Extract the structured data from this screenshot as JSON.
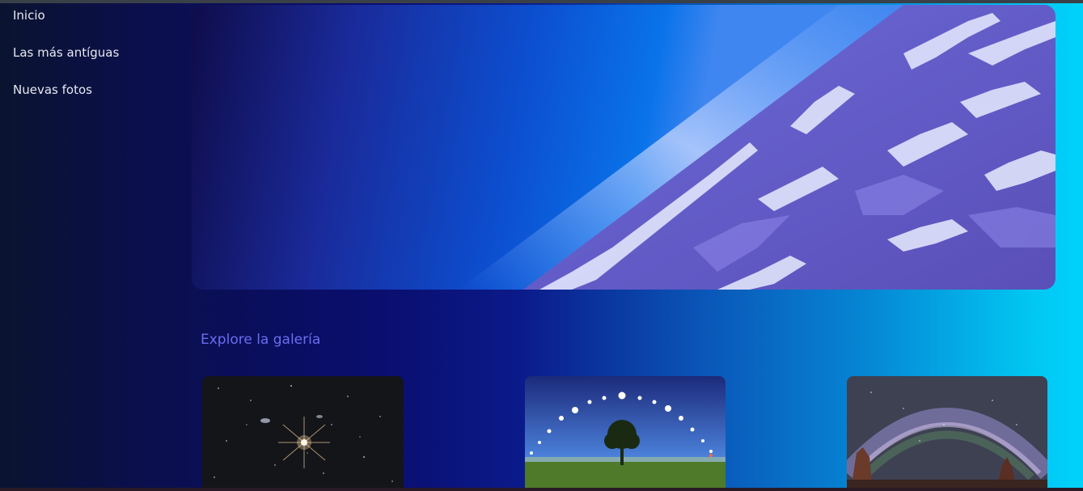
{
  "nav": {
    "items": [
      {
        "label": "Inicio"
      },
      {
        "label": "Las más antíguas"
      },
      {
        "label": "Nuevas fotos"
      }
    ]
  },
  "hero": {
    "image_icon": "earth-horizon-photo"
  },
  "gallery": {
    "title": "Explore la galería",
    "cards": [
      {
        "icon": "bright-star-photo"
      },
      {
        "icon": "sun-arc-tree-photo"
      },
      {
        "icon": "milky-way-arch-photo"
      }
    ]
  },
  "colors": {
    "nav_text": "#e6e8ef",
    "gallery_title": "#6c6cf0",
    "gradient_left": "#0a1430",
    "gradient_right": "#00d2fb"
  }
}
